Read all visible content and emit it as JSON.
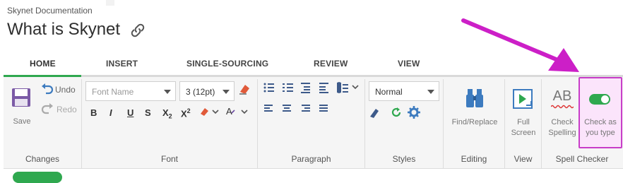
{
  "header": {
    "breadcrumb": "Skynet Documentation",
    "title": "What is Skynet"
  },
  "tabs": [
    {
      "label": "HOME",
      "active": true
    },
    {
      "label": "INSERT",
      "active": false
    },
    {
      "label": "SINGLE-SOURCING",
      "active": false
    },
    {
      "label": "REVIEW",
      "active": false
    },
    {
      "label": "VIEW",
      "active": false
    }
  ],
  "ribbon": {
    "changes": {
      "save": "Save",
      "undo": "Undo",
      "redo": "Redo",
      "label": "Changes"
    },
    "font": {
      "font_name_placeholder": "Font Name",
      "font_size": "3 (12pt)",
      "label": "Font",
      "bold": "B",
      "italic": "I",
      "underline": "U",
      "strike": "S",
      "subscript": "X",
      "sub2": "2",
      "superscript": "X",
      "sup2": "2"
    },
    "paragraph": {
      "label": "Paragraph"
    },
    "styles": {
      "value": "Normal",
      "label": "Styles"
    },
    "editing": {
      "find_replace": "Find/Replace",
      "label": "Editing"
    },
    "view": {
      "full_line1": "Full",
      "full_line2": "Screen",
      "label": "View"
    },
    "spell": {
      "check_line1": "Check",
      "check_line2": "Spelling",
      "type_line1": "Check as",
      "type_line2": "you type",
      "label": "Spell Checker",
      "ab": "AB"
    }
  },
  "colors": {
    "accent": "#2fa84f",
    "highlight": "#c83dc8",
    "arrow": "#cc1fc7",
    "icon_blue": "#3d7bbf"
  }
}
